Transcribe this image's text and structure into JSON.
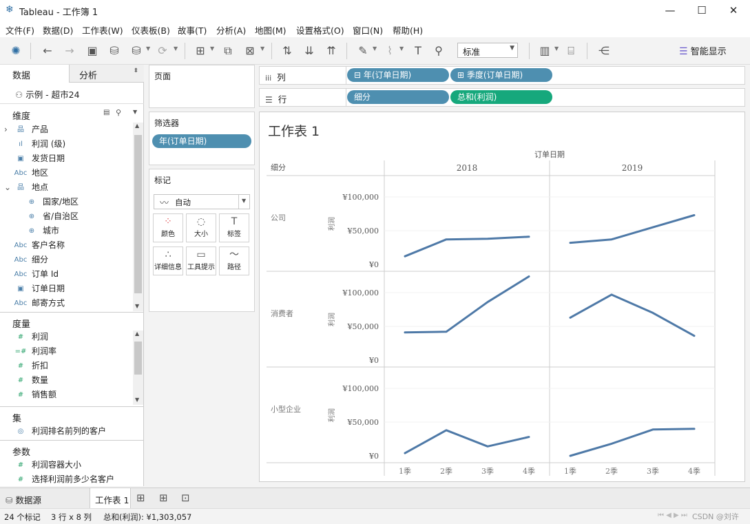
{
  "window": {
    "title": "Tableau - 工作簿 1",
    "minimize": "—",
    "maximize": "☐",
    "close": "✕"
  },
  "menu": [
    "文件(F)",
    "数据(D)",
    "工作表(W)",
    "仪表板(B)",
    "故事(T)",
    "分析(A)",
    "地图(M)",
    "设置格式(O)",
    "窗口(N)",
    "帮助(H)"
  ],
  "toolbar": {
    "fit_value": "标准",
    "show_me_label": "智能显示"
  },
  "datapane": {
    "tab_data": "数据",
    "tab_analysis": "分析",
    "datasource": "示例 - 超市24",
    "dimensions_header": "维度",
    "dimensions": [
      {
        "label": "产品",
        "icon": "hierarchy-icon",
        "glyph": "品",
        "expand": "›"
      },
      {
        "label": "利润 (级)",
        "icon": "bin-icon",
        "glyph": "ıl",
        "expand": ""
      },
      {
        "label": "发货日期",
        "icon": "date-icon",
        "glyph": "▣",
        "expand": ""
      },
      {
        "label": "地区",
        "icon": "string-icon",
        "glyph": "Abc",
        "expand": ""
      },
      {
        "label": "地点",
        "icon": "hierarchy-icon",
        "glyph": "品",
        "expand": "⌄"
      },
      {
        "label": "国家/地区",
        "icon": "globe-icon",
        "glyph": "⊕",
        "expand": "",
        "indent": true
      },
      {
        "label": "省/自治区",
        "icon": "globe-icon",
        "glyph": "⊕",
        "expand": "",
        "indent": true
      },
      {
        "label": "城市",
        "icon": "globe-icon",
        "glyph": "⊕",
        "expand": "",
        "indent": true
      },
      {
        "label": "客户名称",
        "icon": "string-icon",
        "glyph": "Abc",
        "expand": ""
      },
      {
        "label": "细分",
        "icon": "string-icon",
        "glyph": "Abc",
        "expand": ""
      },
      {
        "label": "订单 Id",
        "icon": "string-icon",
        "glyph": "Abc",
        "expand": ""
      },
      {
        "label": "订单日期",
        "icon": "date-icon",
        "glyph": "▣",
        "expand": ""
      },
      {
        "label": "邮寄方式",
        "icon": "string-icon",
        "glyph": "Abc",
        "expand": ""
      }
    ],
    "measures_header": "度量",
    "measures": [
      {
        "label": "利润",
        "icon": "number-icon",
        "glyph": "#"
      },
      {
        "label": "利润率",
        "icon": "calc-number-icon",
        "glyph": "=#"
      },
      {
        "label": "折扣",
        "icon": "number-icon",
        "glyph": "#"
      },
      {
        "label": "数量",
        "icon": "number-icon",
        "glyph": "#"
      },
      {
        "label": "销售额",
        "icon": "number-icon",
        "glyph": "#"
      }
    ],
    "sets_header": "集",
    "sets": [
      {
        "label": "利润排名前列的客户",
        "icon": "set-icon",
        "glyph": "◎"
      }
    ],
    "params_header": "参数",
    "params": [
      {
        "label": "利润容器大小",
        "icon": "number-icon",
        "glyph": "#"
      },
      {
        "label": "选择利润前多少名客户",
        "icon": "number-icon",
        "glyph": "#"
      }
    ]
  },
  "cards": {
    "pages_title": "页面",
    "filters_title": "筛选器",
    "filter_pill": "年(订单日期)",
    "marks_title": "标记",
    "mark_type": "自动",
    "mark_buttons": [
      {
        "label": "颜色",
        "icon": "color-icon",
        "glyph": "⁘"
      },
      {
        "label": "大小",
        "icon": "size-icon",
        "glyph": "◌"
      },
      {
        "label": "标签",
        "icon": "label-icon",
        "glyph": "T"
      },
      {
        "label": "详细信息",
        "icon": "detail-icon",
        "glyph": "∴"
      },
      {
        "label": "工具提示",
        "icon": "tooltip-icon",
        "glyph": "▭"
      },
      {
        "label": "路径",
        "icon": "path-icon",
        "glyph": "〜"
      }
    ]
  },
  "shelves": {
    "columns_label": "列",
    "rows_label": "行",
    "columns_pills": [
      "⊟ 年(订单日期)",
      "⊞ 季度(订单日期)"
    ],
    "rows_pills": [
      "细分",
      "总和(利润)"
    ]
  },
  "view": {
    "sheet_title": "工作表 1",
    "column_header_title": "订单日期",
    "row_header_title": "细分",
    "axis_title": "利润"
  },
  "chart_data": {
    "type": "line",
    "title": "工作表 1",
    "column_field": "订单日期",
    "row_field": "细分",
    "xlabel": "",
    "ylabel": "利润",
    "years": [
      "2018",
      "2019"
    ],
    "quarters": [
      "1季",
      "2季",
      "3季",
      "4季"
    ],
    "segments": [
      "公司",
      "消费者",
      "小型企业"
    ],
    "y_ticks": [
      "¥0",
      "¥50,000",
      "¥100,000"
    ],
    "ylim": [
      0,
      125000
    ],
    "line_color": "#4e79a7",
    "series": [
      {
        "segment": "公司",
        "year": "2018",
        "values": [
          12000,
          37000,
          38000,
          41000
        ]
      },
      {
        "segment": "公司",
        "year": "2019",
        "values": [
          32000,
          37000,
          55000,
          73000
        ]
      },
      {
        "segment": "消费者",
        "year": "2018",
        "values": [
          41000,
          42000,
          86000,
          124000
        ]
      },
      {
        "segment": "消费者",
        "year": "2019",
        "values": [
          63000,
          97000,
          70000,
          36000
        ]
      },
      {
        "segment": "小型企业",
        "year": "2018",
        "values": [
          4000,
          38000,
          14000,
          28000
        ]
      },
      {
        "segment": "小型企业",
        "year": "2019",
        "values": [
          0,
          18000,
          39000,
          40000
        ]
      }
    ]
  },
  "tabs": {
    "datasource": "数据源",
    "sheet1": "工作表 1"
  },
  "status": {
    "marks": "24 个标记",
    "dims": "3 行 x 8 列",
    "sum": "总和(利润): ¥1,303,057",
    "watermark": "CSDN @刘许"
  }
}
